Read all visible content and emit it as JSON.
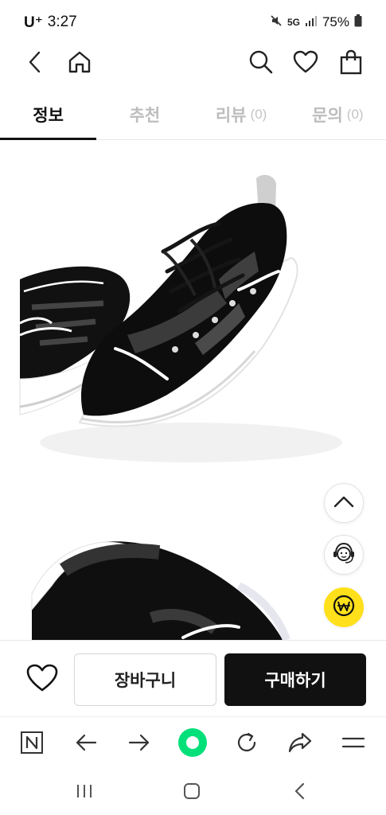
{
  "status_bar": {
    "carrier": "U⁺",
    "time": "3:27",
    "network": "5G",
    "battery": "75%"
  },
  "nav": {
    "back_icon": "chevron-left-icon",
    "home_icon": "home-icon",
    "search_icon": "search-icon",
    "wishlist_icon": "heart-icon",
    "bag_icon": "shopping-bag-icon"
  },
  "tabs": [
    {
      "label": "정보",
      "count": ""
    },
    {
      "label": "추천",
      "count": ""
    },
    {
      "label": "리뷰",
      "count": "(0)"
    },
    {
      "label": "문의",
      "count": "(0)"
    }
  ],
  "floating": {
    "scroll_top_icon": "chevron-up-icon",
    "support_icon": "headset-agent-icon",
    "won_icon": "won-coin-icon"
  },
  "bottom_bar": {
    "like_icon": "heart-outline-icon",
    "cart_label": "장바구니",
    "buy_label": "구매하기"
  },
  "browser_bar": {
    "icons": [
      "naver-n-icon",
      "arrow-left-icon",
      "arrow-right-icon",
      "green-dot-icon",
      "refresh-icon",
      "share-icon",
      "menu-icon"
    ]
  },
  "android_nav": {
    "icons": [
      "recent-apps-icon",
      "home-square-icon",
      "back-chevron-icon"
    ]
  },
  "colors": {
    "accent_black": "#111111",
    "tab_inactive": "#bdbdbd",
    "won_button": "#ffe01b",
    "naver_green": "#03e07a"
  }
}
